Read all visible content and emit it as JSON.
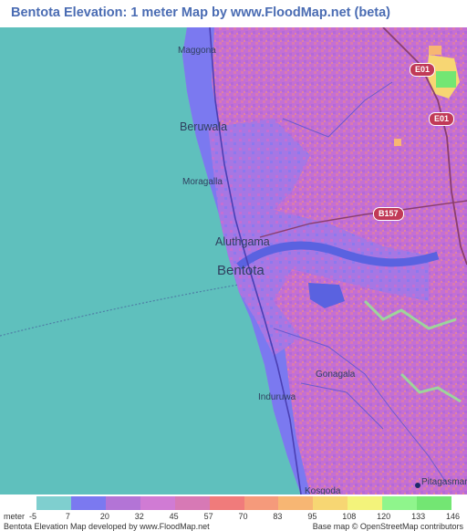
{
  "title": "Bentota Elevation: 1 meter Map by www.FloodMap.net (beta)",
  "places": [
    {
      "name": "Maggona",
      "size": "small"
    },
    {
      "name": "Beruwala",
      "size": "mid"
    },
    {
      "name": "Moragalla",
      "size": "small"
    },
    {
      "name": "Aluthgama",
      "size": "mid"
    },
    {
      "name": "Bentota",
      "size": "big"
    },
    {
      "name": "Gonagala",
      "size": "small"
    },
    {
      "name": "Induruwa",
      "size": "small"
    },
    {
      "name": "Kosgoda",
      "size": "small"
    },
    {
      "name": "Pitagasmar",
      "size": "small"
    }
  ],
  "roads": [
    {
      "label": "E01"
    },
    {
      "label": "E01"
    },
    {
      "label": "B157"
    }
  ],
  "legend": {
    "unit": "meter",
    "ticks": [
      "-5",
      "7",
      "20",
      "32",
      "45",
      "57",
      "70",
      "83",
      "95",
      "108",
      "120",
      "133",
      "146"
    ],
    "colors": [
      "#7fcfcf",
      "#7b79f0",
      "#b374d6",
      "#d07bd4",
      "#d779b5",
      "#f07b7b",
      "#f59a7b",
      "#f7b673",
      "#f7d673",
      "#f3f37b",
      "#8ff58c",
      "#73e673"
    ]
  },
  "colors": {
    "sea": "#5fc0bd",
    "lowland": "#7b79f0",
    "river": "#5a62e0",
    "upland": "#c46fd4",
    "ridge": "#d97ab0"
  },
  "credits": {
    "left": "Bentota Elevation Map developed by www.FloodMap.net",
    "right": "Base map © OpenStreetMap contributors"
  }
}
